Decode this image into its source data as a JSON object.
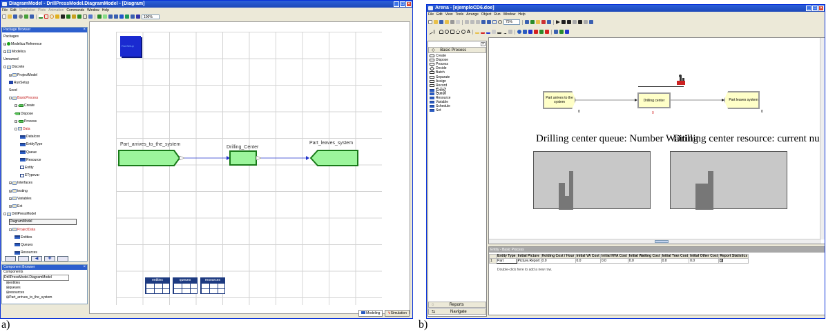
{
  "captions": {
    "a": "a)",
    "b": "b)"
  },
  "left": {
    "title": "DiagramModel - DrillPressModel.DiagramModel - [Diagram]",
    "menu": [
      "File",
      "Edit",
      "Simulation",
      "Plots",
      "Animation",
      "Commands",
      "Window",
      "Help"
    ],
    "zoom": "100%",
    "package_browser": {
      "header": "Package Browser",
      "items": [
        {
          "label": "Packages",
          "indent": 0,
          "icon": "none",
          "exp": ""
        },
        {
          "label": "Modelica Reference",
          "indent": 0,
          "icon": "dot",
          "exp": "+"
        },
        {
          "label": "Modelica",
          "indent": 0,
          "icon": "folder",
          "exp": "+"
        },
        {
          "label": "Unnamed",
          "indent": 0,
          "icon": "none",
          "exp": ""
        },
        {
          "label": "Discrete",
          "indent": 0,
          "icon": "folder",
          "exp": "-"
        },
        {
          "label": "ProjectModel",
          "indent": 1,
          "icon": "folder",
          "exp": "+"
        },
        {
          "label": "RunSetup",
          "indent": 1,
          "icon": "class",
          "exp": ""
        },
        {
          "label": "Seed",
          "indent": 1,
          "icon": "none",
          "exp": ""
        },
        {
          "label": "BasicProcess",
          "indent": 1,
          "icon": "folder",
          "exp": "-",
          "red": true
        },
        {
          "label": "Create",
          "indent": 2,
          "icon": "green",
          "exp": "+"
        },
        {
          "label": "Dispose",
          "indent": 2,
          "icon": "green",
          "exp": ""
        },
        {
          "label": "Process",
          "indent": 2,
          "icon": "green",
          "exp": "+"
        },
        {
          "label": "Data",
          "indent": 2,
          "icon": "folder",
          "exp": "-",
          "red": true
        },
        {
          "label": "DataIcon",
          "indent": 3,
          "icon": "table",
          "exp": ""
        },
        {
          "label": "EntityType",
          "indent": 3,
          "icon": "table",
          "exp": ""
        },
        {
          "label": "Queue",
          "indent": 3,
          "icon": "table",
          "exp": ""
        },
        {
          "label": "Resource",
          "indent": 3,
          "icon": "table",
          "exp": ""
        },
        {
          "label": "Entity",
          "indent": 3,
          "icon": "box",
          "exp": ""
        },
        {
          "label": "ETypevar",
          "indent": 3,
          "icon": "box",
          "exp": ""
        },
        {
          "label": "Interfaces",
          "indent": 1,
          "icon": "folder",
          "exp": "+"
        },
        {
          "label": "testing",
          "indent": 1,
          "icon": "folder",
          "exp": "+"
        },
        {
          "label": "Variables",
          "indent": 1,
          "icon": "folder",
          "exp": "+"
        },
        {
          "label": "Ext",
          "indent": 1,
          "icon": "folder",
          "exp": "+"
        },
        {
          "label": "DrillPressModel",
          "indent": 0,
          "icon": "folder",
          "exp": "-"
        },
        {
          "label": "DiagramModel",
          "indent": 1,
          "icon": "none",
          "exp": "",
          "selected": true
        },
        {
          "label": "ProjectData",
          "indent": 1,
          "icon": "folder",
          "exp": "-",
          "red": true
        },
        {
          "label": "Entities",
          "indent": 2,
          "icon": "table",
          "exp": ""
        },
        {
          "label": "Queues",
          "indent": 2,
          "icon": "table",
          "exp": ""
        },
        {
          "label": "Resources",
          "indent": 2,
          "icon": "table",
          "exp": ""
        }
      ]
    },
    "component_browser": {
      "header": "Component Browser",
      "items": [
        "Components",
        "DrillPressModel.DiagramModel",
        "entities",
        "queues",
        "resources",
        "Part_arrives_to_the_system"
      ]
    },
    "diagram": {
      "runsetup": "RunSetup",
      "create_label": "Part_arrives_to_the_system",
      "process_label": "Drilling_Center",
      "dispose_label": "Part_leaves_system",
      "tables": [
        "entities",
        "queues",
        "resources"
      ]
    },
    "tabs": {
      "modeling": "Modeling",
      "simulation": "Simulation"
    }
  },
  "right": {
    "title": "Arena - [ejemploCD6.doe]",
    "menu": [
      "File",
      "Edit",
      "View",
      "Tools",
      "Arrange",
      "Object",
      "Run",
      "Window",
      "Help"
    ],
    "zoom": "75%",
    "project_bar": {
      "panel": "Basic Process",
      "items": [
        "Create",
        "Dispose",
        "Process",
        "Decide",
        "Batch",
        "Separate",
        "Assign",
        "Record",
        "Entity",
        "Queue",
        "Resource",
        "Variable",
        "Schedule",
        "Set"
      ],
      "bottom": [
        "Reports",
        "Navigate"
      ]
    },
    "modules": {
      "create": "Part arrives to the system",
      "create_count": "0",
      "process": "Drilling center",
      "process_count": "0",
      "dispose": "Part leaves system",
      "dispose_count": "0"
    },
    "plot_titles": {
      "queue": "Drilling center queue: Number Waiting",
      "resource": "Drilling center resource: current number busy"
    },
    "spreadsheet": {
      "header": "Entity - Basic Process",
      "columns": [
        "Entity Type",
        "Initial Picture",
        "Holding Cost / Hour",
        "Initial VA Cost",
        "Initial NVA Cost",
        "Initial Waiting Cost",
        "Initial Tran Cost",
        "Initial Other Cost",
        "Report Statistics"
      ],
      "row": {
        "num": "1",
        "cells": [
          "Part",
          "Picture.Report",
          "0.0",
          "0.0",
          "0.0",
          "0.0",
          "0.0",
          "0.0"
        ]
      },
      "hint": "Double-click here to add a new row."
    }
  }
}
